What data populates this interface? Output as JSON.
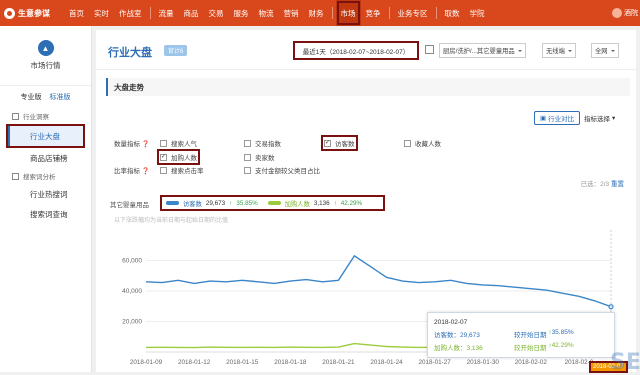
{
  "topnav": {
    "logo": "生意参谋",
    "items": [
      "首页",
      "实时",
      "作战室",
      "流量",
      "商品",
      "交易",
      "服务",
      "物流",
      "营销",
      "财务",
      "市场",
      "竞争",
      "业务专区",
      "取数",
      "学院"
    ],
    "active": "市场",
    "user": "酒院"
  },
  "sidebar": {
    "header": "市场行情",
    "versions": [
      "专业版",
      "标准版"
    ],
    "groups": [
      {
        "label": "行业洞察",
        "items": [
          "行业大盘",
          "商品店铺榜"
        ]
      },
      {
        "label": "搜索词分析",
        "items": [
          "行业热搜词",
          "搜索词查询"
        ]
      }
    ],
    "active": "行业大盘"
  },
  "header": {
    "title": "行业大盘",
    "badge": "官计6",
    "date_range": "最近1天（2018-02-07~2018-02-07）",
    "category": "厨房/洗护/...其它婴童用品",
    "terminal": "无线端",
    "network": "全网"
  },
  "section": {
    "title": "大盘走势"
  },
  "controls": {
    "compare": "行业对比",
    "select": "指标选择"
  },
  "metrics": {
    "label_quantity": "数量指标",
    "label_ratio": "比率指标",
    "label_other": "其它婴童用品",
    "options": [
      {
        "label": "搜索人气",
        "checked": false
      },
      {
        "label": "交易指数",
        "checked": false
      },
      {
        "label": "访客数",
        "checked": true
      },
      {
        "label": "收藏人数",
        "checked": false
      },
      {
        "label": "加购人数",
        "checked": true
      },
      {
        "label": "卖家数",
        "checked": false
      },
      {
        "label": "搜索点击率",
        "checked": false
      },
      {
        "label": "支付金额较父类目占比",
        "checked": false
      }
    ],
    "selected_text": "已选：2/3",
    "reset": "重置"
  },
  "legend": {
    "visitors": {
      "name": "访客数",
      "value": "29,673",
      "change": "35.85%"
    },
    "cart": {
      "name": "加购人数",
      "value": "3,136",
      "change": "42.29%"
    }
  },
  "chart_note": "以下涨跌幅均为当前日期与起始日期的比值",
  "chart_data": {
    "type": "line",
    "x": [
      "2018-01-09",
      "2018-01-10",
      "2018-01-11",
      "2018-01-12",
      "2018-01-13",
      "2018-01-14",
      "2018-01-15",
      "2018-01-16",
      "2018-01-17",
      "2018-01-18",
      "2018-01-19",
      "2018-01-20",
      "2018-01-21",
      "2018-01-22",
      "2018-01-23",
      "2018-01-24",
      "2018-01-25",
      "2018-01-26",
      "2018-01-27",
      "2018-01-28",
      "2018-01-29",
      "2018-01-30",
      "2018-01-31",
      "2018-02-01",
      "2018-02-02",
      "2018-02-03",
      "2018-02-04",
      "2018-02-05",
      "2018-02-06",
      "2018-02-07"
    ],
    "xticks": [
      "2018-01-09",
      "2018-01-12",
      "2018-01-15",
      "2018-01-18",
      "2018-01-21",
      "2018-01-24",
      "2018-01-27",
      "2018-01-30",
      "2018-02-02",
      "2018-02-0"
    ],
    "yticks": [
      "60,000",
      "40,000",
      "20,000"
    ],
    "ylim": [
      0,
      80000
    ],
    "series": [
      {
        "name": "访客数",
        "color": "#3b86c8",
        "values": [
          46000,
          45500,
          47000,
          45000,
          46500,
          46000,
          47000,
          46000,
          45000,
          46500,
          47500,
          46000,
          47000,
          63000,
          56000,
          49000,
          46500,
          45500,
          46000,
          47000,
          45000,
          44000,
          43500,
          42500,
          41500,
          40500,
          38500,
          36500,
          33500,
          29673
        ]
      },
      {
        "name": "加购人数",
        "color": "#9ccc3c",
        "values": [
          3000,
          3100,
          3000,
          2900,
          3200,
          3100,
          3000,
          3100,
          3000,
          3200,
          3100,
          3000,
          3200,
          5500,
          4500,
          3600,
          3200,
          3000,
          3100,
          3300,
          3200,
          3100,
          3100,
          3000,
          3200,
          3100,
          3000,
          3100,
          3200,
          3136
        ]
      }
    ]
  },
  "tooltip": {
    "date": "2018-02-07",
    "row1_label": "访客数：",
    "row1_value": "29,673",
    "row1_note": "较开始日期",
    "row1_change": "35.85%",
    "row2_label": "加购人数：",
    "row2_value": "3,136",
    "row2_note": "较开始日期",
    "row2_change": "42.29%"
  },
  "last_date": "2018-02-07",
  "watermark": "SEO"
}
